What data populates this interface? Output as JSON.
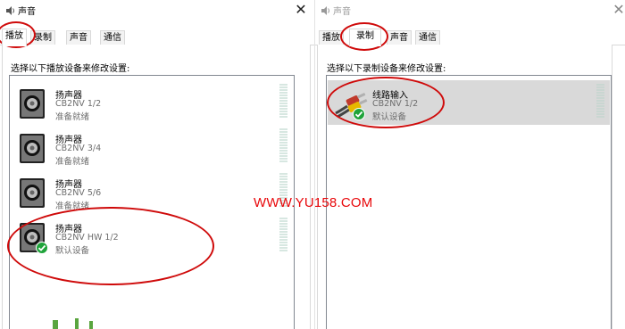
{
  "watermark": "WWW.YU158.COM",
  "colors": {
    "annotation": "#cf0a0a",
    "default_check": "#1fa33a",
    "level_meter": "#d7e7e1",
    "selected_row": "#d9d9d9"
  },
  "left_window": {
    "title": "声音",
    "title_icon": "speaker-icon",
    "close_label": "✕",
    "tabs": [
      {
        "label": "播放",
        "active": true
      },
      {
        "label": "录制",
        "active": false
      },
      {
        "label": "声音",
        "active": false
      },
      {
        "label": "通信",
        "active": false
      }
    ],
    "instruction": "选择以下播放设备来修改设置:",
    "devices": [
      {
        "name": "扬声器",
        "sub": "CB2NV 1/2",
        "status": "准备就绪",
        "icon": "speaker-device-icon",
        "default": false
      },
      {
        "name": "扬声器",
        "sub": "CB2NV 3/4",
        "status": "准备就绪",
        "icon": "speaker-device-icon",
        "default": false
      },
      {
        "name": "扬声器",
        "sub": "CB2NV 5/6",
        "status": "准备就绪",
        "icon": "speaker-device-icon",
        "default": false
      },
      {
        "name": "扬声器",
        "sub": "CB2NV HW 1/2",
        "status": "默认设备",
        "icon": "speaker-device-icon",
        "default": true
      }
    ]
  },
  "right_window": {
    "title": "声音",
    "title_icon": "speaker-icon",
    "close_label": "✕",
    "tabs": [
      {
        "label": "播放",
        "active": false
      },
      {
        "label": "录制",
        "active": true
      },
      {
        "label": "声音",
        "active": false
      },
      {
        "label": "通信",
        "active": false
      }
    ],
    "instruction": "选择以下录制设备来修改设置:",
    "devices": [
      {
        "name": "线路输入",
        "sub": "CB2NV 1/2",
        "status": "默认设备",
        "icon": "line-in-cable-icon",
        "default": true,
        "selected": true
      }
    ]
  }
}
